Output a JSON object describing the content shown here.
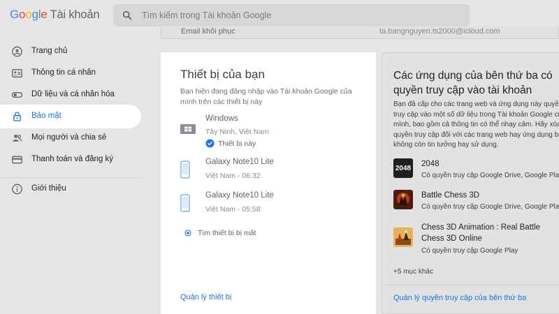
{
  "header": {
    "logo_letters": [
      "G",
      "o",
      "o",
      "g",
      "l",
      "e"
    ],
    "product": "Tài khoản",
    "search_placeholder": "Tìm kiếm trong Tài khoản Google"
  },
  "sidebar": {
    "items": [
      {
        "label": "Trang chủ",
        "icon": "person-circle-icon"
      },
      {
        "label": "Thông tin cá nhân",
        "icon": "id-card-icon"
      },
      {
        "label": "Dữ liệu và cá nhân hóa",
        "icon": "toggle-icon"
      },
      {
        "label": "Bảo mật",
        "icon": "lock-icon",
        "active": true
      },
      {
        "label": "Mọi người và chia sẻ",
        "icon": "people-icon"
      },
      {
        "label": "Thanh toán và đăng ký",
        "icon": "credit-card-icon"
      },
      {
        "label": "Giới thiệu",
        "icon": "info-icon"
      }
    ]
  },
  "topcard": {
    "left_text": "Email khôi phục",
    "right_text": "ta.bangnguyen.ts2000@icloud.com"
  },
  "devices_card": {
    "title": "Thiết bị của bạn",
    "description": "Bạn hiện đang đăng nhập vào Tài khoản Google của mình trên các thiết bị này",
    "devices": [
      {
        "name": "Windows",
        "location": "Tây Ninh, Việt Nam",
        "this_device": "Thiết bị này",
        "icon": "laptop-icon"
      },
      {
        "name": "Galaxy Note10 Lite",
        "location": "Việt Nam - 06:32",
        "icon": "phone-icon"
      },
      {
        "name": "Galaxy Note10 Lite",
        "location": "Việt Nam - 05:58",
        "icon": "phone-icon"
      }
    ],
    "find_lost": "Tìm thiết bị bị mất",
    "manage_link": "Quản lý thiết bị"
  },
  "third_party_card": {
    "title": "Các ứng dụng của bên thứ ba có quyền truy cập vào tài khoản",
    "description_lines": [
      "Bạn đã cấp cho các trang web và ứng dụng này quyền",
      "truy cập vào một số dữ liệu trong Tài khoản Google của",
      "mình, bao gồm cả thông tin có thể nhạy cảm. Hãy xóa",
      "quyền truy cập đối với các trang web hay ứng dụng bạn",
      "không còn tin tưởng hay sử dụng."
    ],
    "apps": [
      {
        "name": "2048",
        "access": "Có quyền truy cập Google Drive, Google Play",
        "icon_text": "2048",
        "icon": "app-2048-icon"
      },
      {
        "name": "Battle Chess 3D",
        "access": "Có quyền truy cập Google Drive, Google Play",
        "icon": "battle-chess-icon"
      },
      {
        "name_line1": "Chess 3D Animation : Real Battle",
        "name_line2": "Chess 3D Online",
        "access": "Có quyền truy cập Google Play",
        "icon": "chess-3d-icon"
      }
    ],
    "more": "+5 mục khác",
    "manage_link": "Quản lý quyền truy cập của bên thứ ba"
  }
}
